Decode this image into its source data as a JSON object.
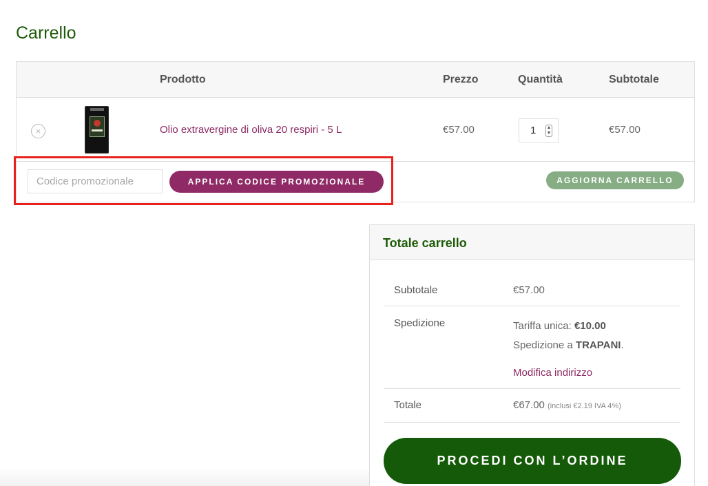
{
  "page": {
    "title": "Carrello"
  },
  "cart": {
    "headers": {
      "product": "Prodotto",
      "price": "Prezzo",
      "quantity": "Quantità",
      "subtotal": "Subtotale"
    },
    "items": [
      {
        "remove_icon": "close-circle-icon",
        "remove_glyph": "×",
        "name": "Olio extravergine di oliva 20 respiri - 5 L",
        "price": "€57.00",
        "quantity": "1",
        "subtotal": "€57.00"
      }
    ],
    "coupon": {
      "placeholder": "Codice promozionale",
      "value": "",
      "apply_label": "APPLICA CODICE PROMOZIONALE"
    },
    "update_label": "AGGIORNA CARRELLO"
  },
  "totals": {
    "title": "Totale carrello",
    "subtotal_label": "Subtotale",
    "subtotal_value": "€57.00",
    "shipping_label": "Spedizione",
    "shipping_rate_prefix": "Tariffa unica: ",
    "shipping_rate_value": "€10.00",
    "shipping_dest_prefix": "Spedizione a ",
    "shipping_dest_value": "TRAPANI",
    "shipping_dest_suffix": ".",
    "edit_address": "Modifica indirizzo",
    "total_label": "Totale",
    "total_value": "€67.00",
    "total_tax_note": "(inclusi €2.19 IVA 4%)",
    "checkout_label": "PROCEDI CON L’ORDINE"
  },
  "colors": {
    "brand_green": "#1e5b07",
    "accent_purple": "#902a66",
    "update_green": "#86ad83",
    "highlight_red": "#e8211d"
  }
}
